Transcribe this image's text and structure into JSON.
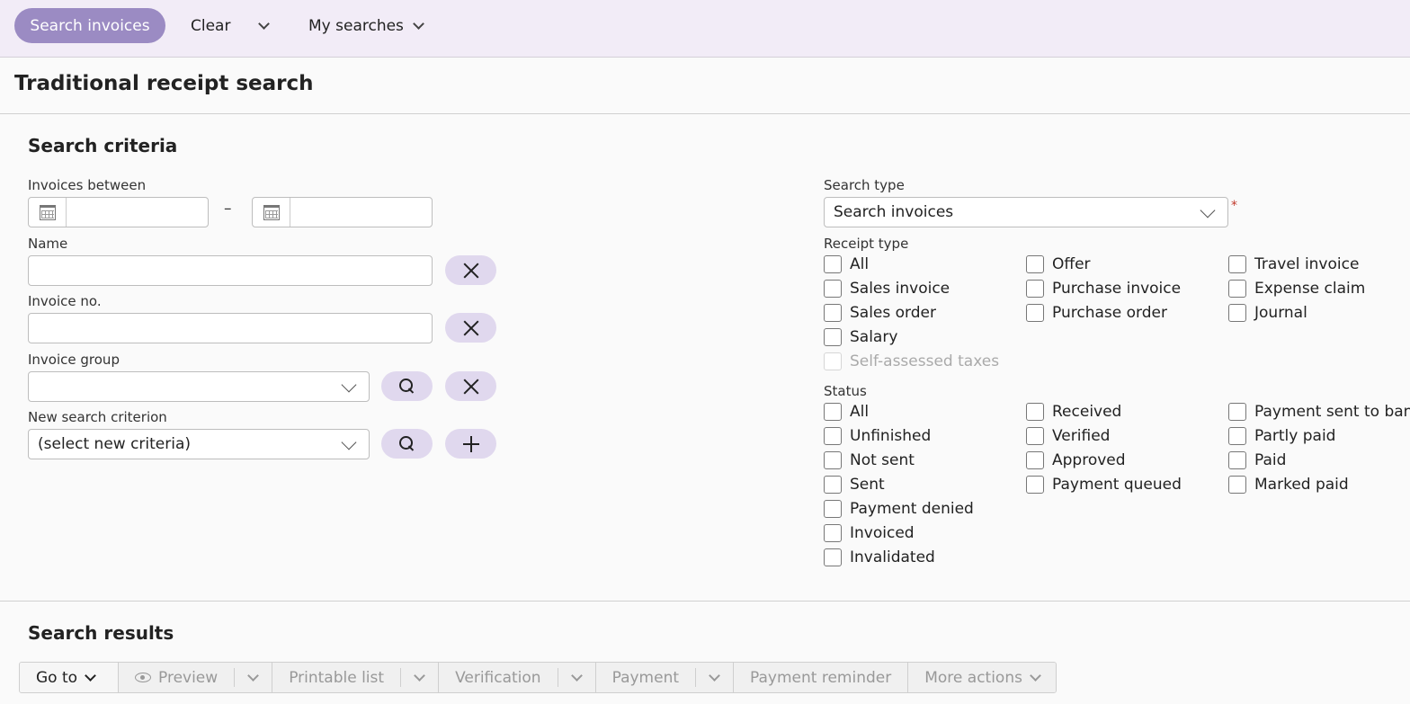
{
  "topbar": {
    "search_button": "Search invoices",
    "clear": "Clear",
    "my_searches": "My searches"
  },
  "page": {
    "title": "Traditional receipt search"
  },
  "criteria": {
    "title": "Search criteria",
    "invoices_between_label": "Invoices between",
    "date_from": "",
    "date_to": "",
    "name_label": "Name",
    "name_value": "",
    "invoice_no_label": "Invoice no.",
    "invoice_no_value": "",
    "invoice_group_label": "Invoice group",
    "invoice_group_value": "",
    "new_criterion_label": "New search criterion",
    "new_criterion_value": "(select new criteria)",
    "search_type_label": "Search type",
    "search_type_value": "Search invoices",
    "required_mark": "*",
    "receipt_type_label": "Receipt type",
    "receipt_types": [
      {
        "label": "All",
        "checked": false
      },
      {
        "label": "Offer",
        "checked": false
      },
      {
        "label": "Travel invoice",
        "checked": false
      },
      {
        "label": "Sales invoice",
        "checked": false
      },
      {
        "label": "Purchase invoice",
        "checked": false
      },
      {
        "label": "Expense claim",
        "checked": false
      },
      {
        "label": "Sales order",
        "checked": false
      },
      {
        "label": "Purchase order",
        "checked": false
      },
      {
        "label": "Journal",
        "checked": false
      },
      {
        "label": "Salary",
        "checked": false
      },
      {
        "label": "Self-assessed taxes",
        "checked": false,
        "disabled": true
      }
    ],
    "status_label": "Status",
    "statuses": [
      {
        "label": "All",
        "checked": false
      },
      {
        "label": "Received",
        "checked": false
      },
      {
        "label": "Payment sent to bank",
        "checked": false
      },
      {
        "label": "Unfinished",
        "checked": false
      },
      {
        "label": "Verified",
        "checked": false
      },
      {
        "label": "Partly paid",
        "checked": false
      },
      {
        "label": "Not sent",
        "checked": false
      },
      {
        "label": "Approved",
        "checked": false
      },
      {
        "label": "Paid",
        "checked": false
      },
      {
        "label": "Sent",
        "checked": false
      },
      {
        "label": "Payment queued",
        "checked": false
      },
      {
        "label": "Marked paid",
        "checked": false
      },
      {
        "label": "Payment denied",
        "checked": false
      },
      {
        "label": "Invoiced",
        "checked": false
      },
      {
        "label": "Invalidated",
        "checked": false
      }
    ]
  },
  "results": {
    "title": "Search results",
    "toolbar": {
      "goto": "Go to",
      "preview": "Preview",
      "printable_list": "Printable list",
      "verification": "Verification",
      "payment": "Payment",
      "payment_reminder": "Payment reminder",
      "more_actions": "More actions"
    }
  },
  "colors": {
    "accent": "#9b8bc3",
    "topbar_bg": "#f2ecf7",
    "pill_bg": "#e0d8ee",
    "required": "#c0392b"
  }
}
